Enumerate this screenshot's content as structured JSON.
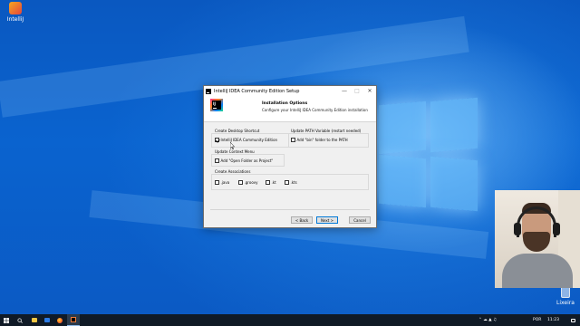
{
  "desktop": {
    "icons": [
      {
        "name": "IntelliJ",
        "icon": "intellij-installer-icon"
      },
      {
        "name": "Lixeira",
        "icon": "recycle-bin-icon"
      }
    ]
  },
  "dialog": {
    "title": "IntelliJ IDEA Community Edition Setup",
    "header_title": "Installation Options",
    "header_subtitle": "Configure your IntelliJ IDEA Community Edition installation",
    "groups": {
      "desktop_shortcut": {
        "label": "Create Desktop Shortcut",
        "option": "IntelliJ IDEA Community Edition",
        "checked": true
      },
      "path_variable": {
        "label": "Update PATH Variable (restart needed)",
        "option": "Add \"bin\" folder to the PATH",
        "checked": false
      },
      "context_menu": {
        "label": "Update Context Menu",
        "option": "Add \"Open Folder as Project\"",
        "checked": false
      },
      "associations": {
        "label": "Create Associations",
        "options": [
          {
            "label": ".java",
            "checked": false
          },
          {
            "label": ".groovy",
            "checked": false
          },
          {
            "label": ".kt",
            "checked": false
          },
          {
            "label": ".kts",
            "checked": false
          }
        ]
      }
    },
    "buttons": {
      "back": "< Back",
      "next": "Next >",
      "cancel": "Cancel"
    }
  },
  "taskbar": {
    "apps": [
      "start-icon",
      "search-icon",
      "file-explorer-icon",
      "store-icon",
      "firefox-icon",
      "intellij-setup-icon"
    ],
    "tray": {
      "language": "POR",
      "time": "11:23"
    }
  },
  "colors": {
    "desktop": "#0a5fc6",
    "taskbar": "#101a26",
    "accent": "#0078d7"
  }
}
